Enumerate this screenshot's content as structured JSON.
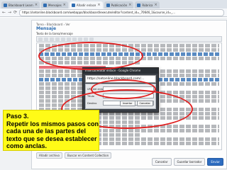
{
  "browser": {
    "tabs": [
      {
        "label": "Blackboard Learn",
        "active": false
      },
      {
        "label": "Mensajes",
        "active": false
      },
      {
        "label": "Añadir enlace",
        "active": true
      },
      {
        "label": "Publicación",
        "active": false
      },
      {
        "label": "Rúbrica",
        "active": false
      }
    ],
    "url": "https://setonline.blackboard.com/webapps/blackboard/execute/editor?content_id=_70646_1&course_id=_..."
  },
  "page": {
    "breadcrumb": "Tarea › Blackboard › Ver",
    "title": "Mensaje",
    "label": "Texto de la tarea/mensaje",
    "lower_buttons": [
      "Añadir archivo",
      "Buscar en Content Collection"
    ],
    "actions": {
      "cancel": "Cancelar",
      "draft": "Guardar borrador",
      "submit": "Enviar"
    }
  },
  "popup": {
    "title": "Insertar/editar enlace - Google Chrome",
    "url": "https://setonline.blackboard.com/...",
    "fields": [
      {
        "label": "URL del enlace"
      },
      {
        "label": "Título"
      },
      {
        "label": "Destino"
      }
    ],
    "buttons": {
      "insert": "Insertar",
      "cancel": "Cancelar"
    }
  },
  "caption": {
    "lines": [
      "Paso 3.",
      "Repetir los mismos pasos con",
      "cada una de las partes del",
      "texto que se desea establecer",
      "como anclas."
    ]
  },
  "colors": {
    "annotation": "#e02020",
    "callout_bg": "#fffb17",
    "primary_button": "#2d6cc0"
  }
}
